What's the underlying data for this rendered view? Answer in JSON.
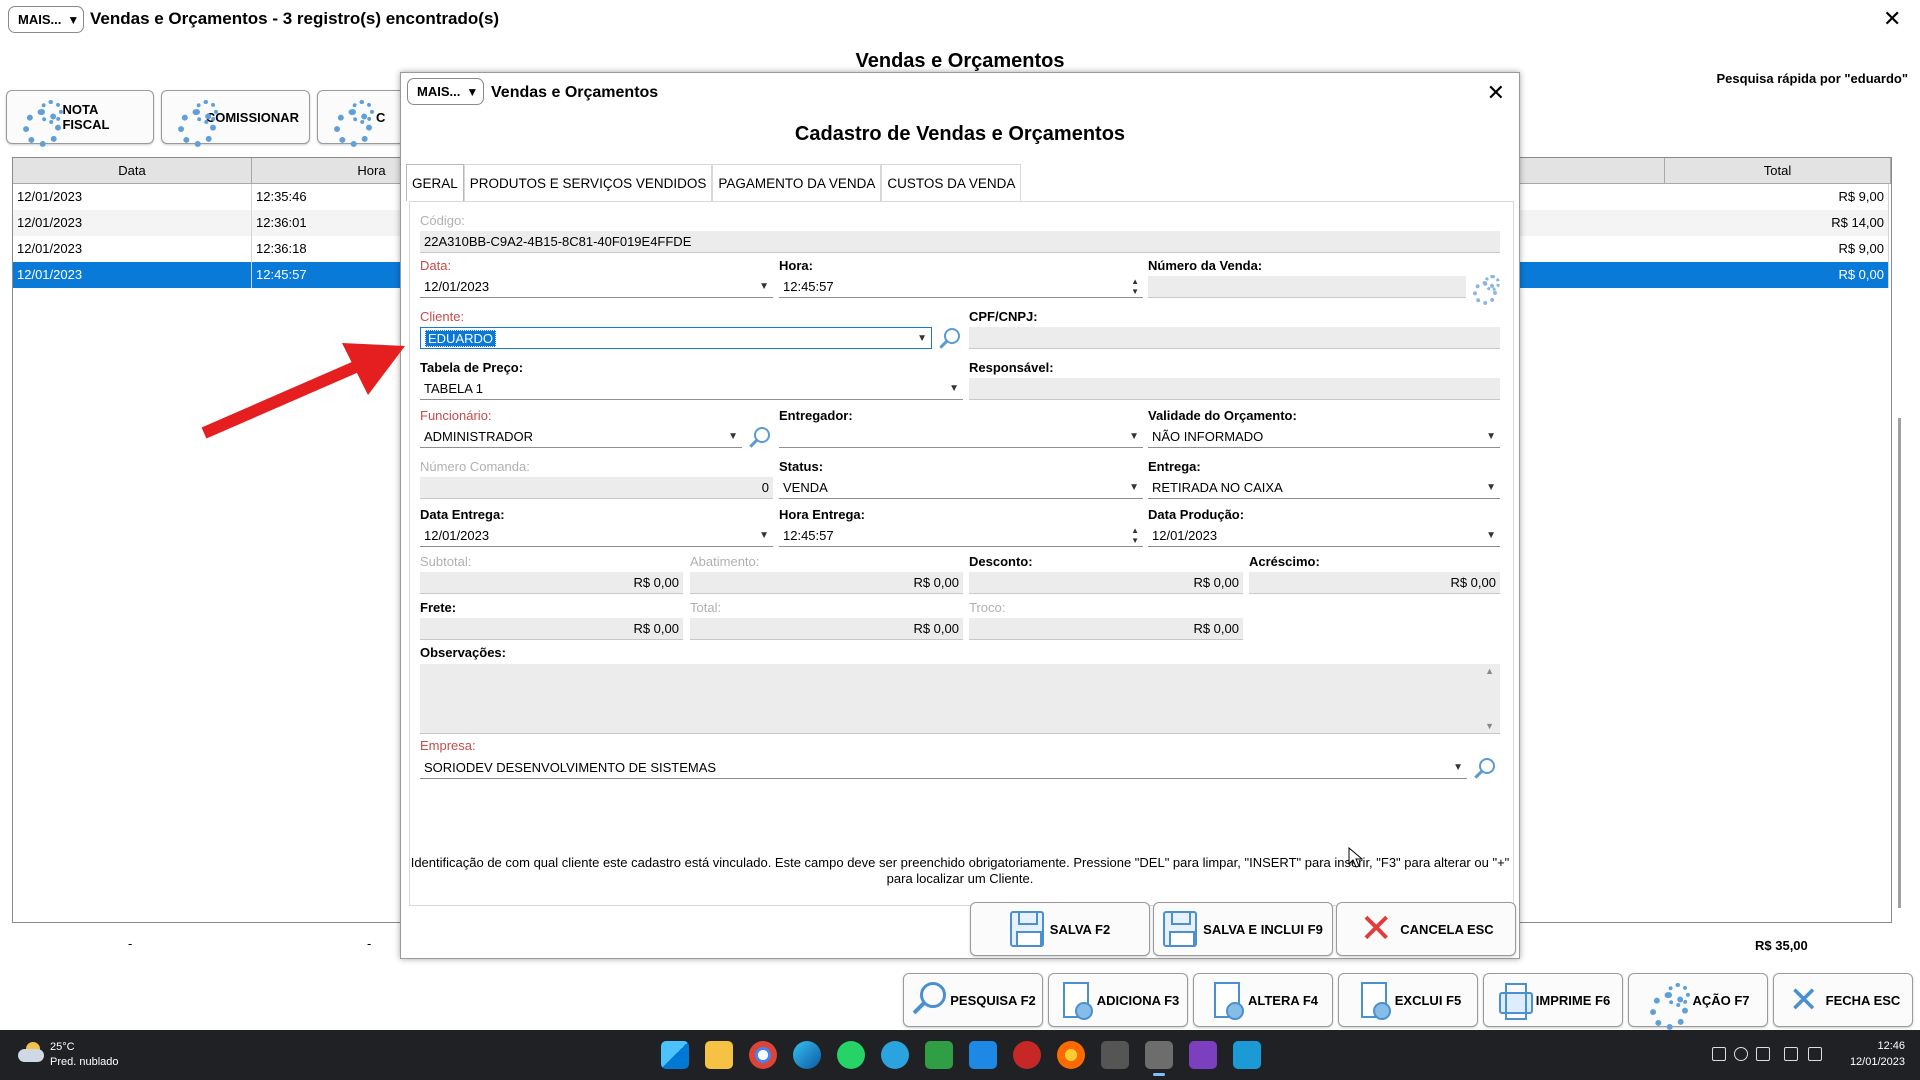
{
  "main_window": {
    "menu_label": "MAIS...",
    "title": "Vendas e Orçamentos - 3 registro(s) encontrado(s)",
    "close_glyph": "✕",
    "heading": "Vendas e Orçamentos",
    "quick_search": "Pesquisa rápida por \"eduardo\"",
    "toolbar": [
      "NOTA FISCAL",
      "COMISSIONAR",
      "C"
    ],
    "grid": {
      "columns": [
        "Data",
        "Hora",
        "Total"
      ],
      "rows": [
        {
          "data": "12/01/2023",
          "hora": "12:35:46",
          "total": "R$ 9,00"
        },
        {
          "data": "12/01/2023",
          "hora": "12:36:01",
          "total": "R$ 14,00"
        },
        {
          "data": "12/01/2023",
          "hora": "12:36:18",
          "total": "R$ 9,00"
        },
        {
          "data": "12/01/2023",
          "hora": "12:45:57",
          "total": "R$ 0,00"
        }
      ],
      "selected_row": 3,
      "footer_total": "R$ 35,00",
      "footer_dash": "-"
    },
    "bottom_buttons": [
      {
        "label": "PESQUISA F2",
        "icon": "search-icon"
      },
      {
        "label": "ADICIONA F3",
        "icon": "add-document-icon"
      },
      {
        "label": "ALTERA F4",
        "icon": "edit-document-icon"
      },
      {
        "label": "EXCLUI F5",
        "icon": "delete-document-icon"
      },
      {
        "label": "IMPRIME F6",
        "icon": "printer-icon"
      },
      {
        "label": "AÇÃO F7",
        "icon": "gear-icon"
      },
      {
        "label": "FECHA ESC",
        "icon": "close-icon"
      }
    ]
  },
  "dialog": {
    "menu_label": "MAIS...",
    "title": "Vendas e Orçamentos",
    "close_glyph": "✕",
    "heading": "Cadastro de Vendas e Orçamentos",
    "tabs": [
      "GERAL",
      "PRODUTOS E SERVIÇOS VENDIDOS",
      "PAGAMENTO DA VENDA",
      "CUSTOS DA VENDA"
    ],
    "active_tab": 0,
    "fields": {
      "codigo": {
        "label": "Código:",
        "value": "22A310BB-C9A2-4B15-8C81-40F019E4FFDE"
      },
      "data": {
        "label": "Data:",
        "value": "12/01/2023"
      },
      "hora": {
        "label": "Hora:",
        "value": "12:45:57"
      },
      "numero_venda": {
        "label": "Número da Venda:",
        "value": ""
      },
      "cliente": {
        "label": "Cliente:",
        "value": "EDUARDO"
      },
      "cpf_cnpj": {
        "label": "CPF/CNPJ:",
        "value": ""
      },
      "tabela_preco": {
        "label": "Tabela de Preço:",
        "value": "TABELA 1"
      },
      "responsavel": {
        "label": "Responsável:",
        "value": ""
      },
      "funcionario": {
        "label": "Funcionário:",
        "value": "ADMINISTRADOR"
      },
      "entregador": {
        "label": "Entregador:",
        "value": ""
      },
      "validade": {
        "label": "Validade do Orçamento:",
        "value": "NÃO INFORMADO"
      },
      "numero_comanda": {
        "label": "Número Comanda:",
        "value": "0"
      },
      "status": {
        "label": "Status:",
        "value": "VENDA"
      },
      "entrega": {
        "label": "Entrega:",
        "value": "RETIRADA NO CAIXA"
      },
      "data_entrega": {
        "label": "Data Entrega:",
        "value": "12/01/2023"
      },
      "hora_entrega": {
        "label": "Hora Entrega:",
        "value": "12:45:57"
      },
      "data_producao": {
        "label": "Data Produção:",
        "value": "12/01/2023"
      },
      "subtotal": {
        "label": "Subtotal:",
        "value": "R$ 0,00"
      },
      "abatimento": {
        "label": "Abatimento:",
        "value": "R$ 0,00"
      },
      "desconto": {
        "label": "Desconto:",
        "value": "R$ 0,00"
      },
      "acrescimo": {
        "label": "Acréscimo:",
        "value": "R$ 0,00"
      },
      "frete": {
        "label": "Frete:",
        "value": "R$ 0,00"
      },
      "total": {
        "label": "Total:",
        "value": "R$ 0,00"
      },
      "troco": {
        "label": "Troco:",
        "value": "R$ 0,00"
      },
      "observacoes": {
        "label": "Observações:",
        "value": ""
      },
      "empresa": {
        "label": "Empresa:",
        "value": "SORIODEV DESENVOLVIMENTO DE SISTEMAS"
      }
    },
    "help_text": "Identificação de com qual cliente este cadastro está vinculado. Este campo deve ser preenchido obrigatoriamente. Pressione \"DEL\" para limpar, \"INSERT\" para inserir, \"F3\" para alterar ou \"+\" para localizar um Cliente.",
    "buttons": [
      "SALVA F2",
      "SALVA E INCLUI F9",
      "CANCELA ESC"
    ]
  },
  "taskbar": {
    "weather_temp": "25°C",
    "weather_desc": "Pred. nublado",
    "time": "12:46",
    "date": "12/01/2023"
  },
  "colors": {
    "selection": "#0a7ad8",
    "required_label": "#c84a4a",
    "annotation_arrow": "#e51f1f"
  }
}
